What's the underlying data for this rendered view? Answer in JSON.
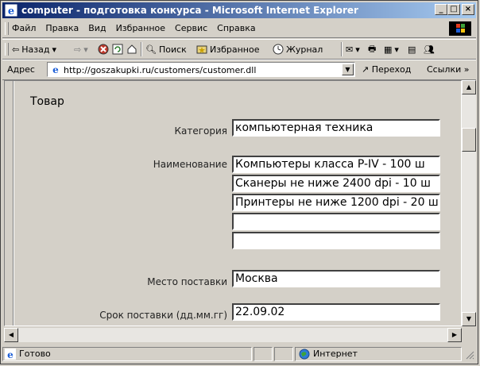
{
  "window": {
    "title": "computer - подготовка конкурса - Microsoft Internet Explorer",
    "min_glyph": "_",
    "max_glyph": "□",
    "close_glyph": "×"
  },
  "menu": {
    "items": [
      "Файл",
      "Правка",
      "Вид",
      "Избранное",
      "Сервис",
      "Справка"
    ]
  },
  "toolbar": {
    "back": "Назад",
    "search": "Поиск",
    "favorites": "Избранное",
    "history": "Журнал"
  },
  "address": {
    "label": "Адрес",
    "url": "http://goszakupki.ru/customers/customer.dll",
    "go": "Переход",
    "links": "Ссылки »"
  },
  "form": {
    "section_title": "Товар",
    "category_label": "Категория",
    "category_value": "компьютерная техника",
    "name_label": "Наименование",
    "name_values": [
      "Компьютеры класса P-IV - 100 ш",
      "Сканеры не ниже 2400 dpi - 10 ш",
      "Принтеры не ниже 1200 dpi - 20 ш",
      "",
      ""
    ],
    "place_label": "Место поставки",
    "place_value": "Москва",
    "term_label": "Срок поставки (дд.мм.гг)",
    "term_value": "22.09.02"
  },
  "status": {
    "text": "Готово",
    "zone": "Интернет"
  },
  "colors": {
    "titlebar_start": "#0a246a",
    "titlebar_end": "#a6caf0",
    "chrome": "#d4d0c8"
  }
}
